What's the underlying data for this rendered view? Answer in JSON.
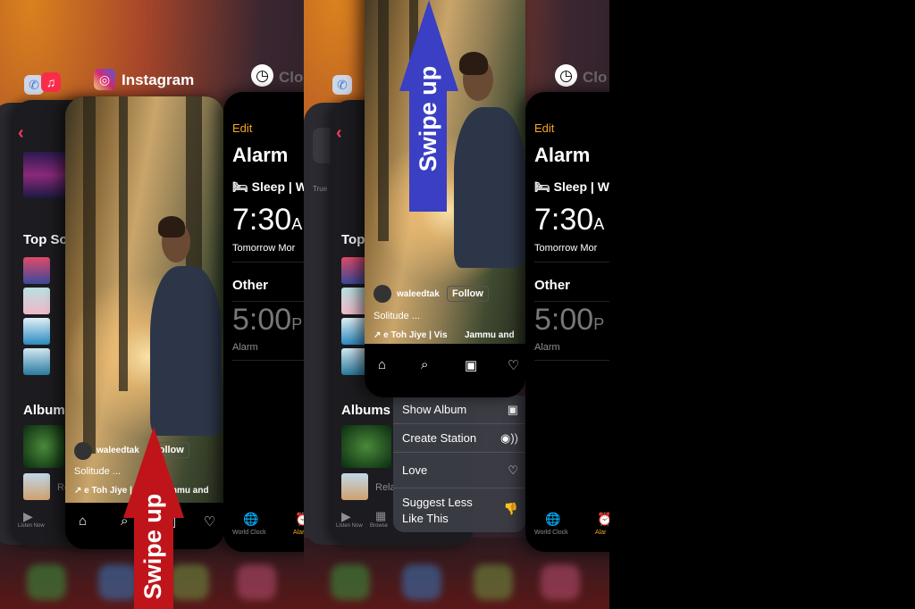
{
  "app_switcher": {
    "instagram": {
      "app_name": "Instagram",
      "username": "waleedtak",
      "follow": "Follow",
      "caption": "Solitude ...",
      "audio": "↗ е Toh Jiye | Vis",
      "location": "Jammu and",
      "nav_icons": [
        "home-icon",
        "search-icon",
        "reels-icon",
        "heart-icon"
      ]
    },
    "music": {
      "top_section": "Top So",
      "top_section_right": "Top",
      "albums": "Album",
      "albums_right": "Albums",
      "recent_item": "Re",
      "recent_item_right": "Rela",
      "tab_listen_now": "Listen Now",
      "tab_browse": "Browse",
      "true_label": "True"
    },
    "clock": {
      "app_name": "Clo",
      "edit": "Edit",
      "title": "Alarm",
      "sleep": "Sleep | W",
      "alarm_time": "7:30",
      "alarm_ampm": "A",
      "alarm_label": "Tomorrow Mor",
      "other": "Other",
      "other_time": "5:00",
      "other_ampm": "P",
      "other_label": "Alarm",
      "tab_world_clock": "World Clock",
      "tab_alarm": "Alar"
    },
    "context_menu": [
      {
        "label": "Show Album",
        "icon": "album-icon"
      },
      {
        "label": "Create Station",
        "icon": "station-icon"
      },
      {
        "label": "Love",
        "icon": "heart-icon"
      },
      {
        "label": "Suggest Less Like This",
        "icon": "thumbs-down-icon"
      }
    ]
  },
  "annotations": {
    "left": {
      "text": "Swipe up",
      "color": "#c0141b"
    },
    "right": {
      "text": "Swipe up",
      "color": "#3a3fc4"
    }
  },
  "colors": {
    "accent_orange": "#f5a623",
    "back_red": "#ff375f"
  }
}
